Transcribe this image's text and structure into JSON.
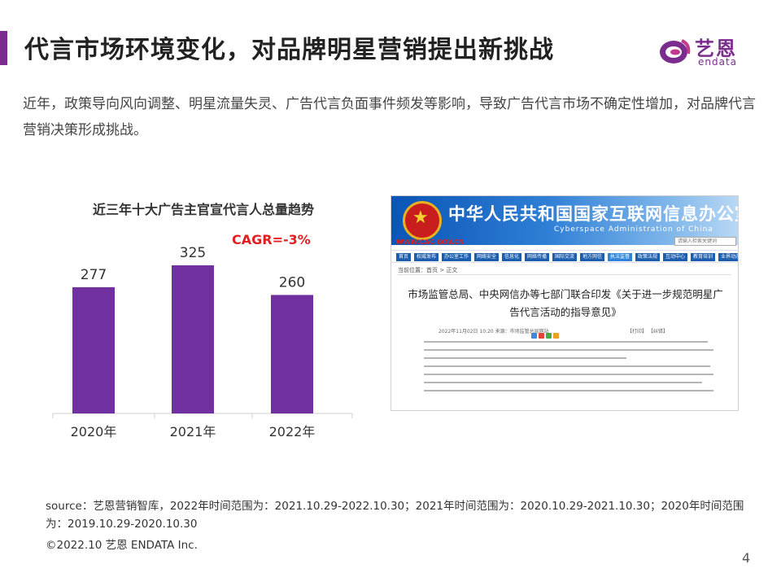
{
  "header": {
    "title": "代言市场环境变化，对品牌明星营销提出新挑战"
  },
  "logo": {
    "cn": "艺恩",
    "en": "endata"
  },
  "intro": "近年，政策导向风向调整、明星流量失灵、广告代言负面事件频发等影响，导致广告代言市场不确定性增加，对品牌代言营销决策形成挑战。",
  "chart_data": {
    "type": "bar",
    "title": "近三年十大广告主官宣代言人总量趋势",
    "categories": [
      "2020年",
      "2021年",
      "2022年"
    ],
    "values": [
      277,
      325,
      260
    ],
    "annotation": "CAGR=-3%",
    "ylim": [
      0,
      400
    ],
    "grid": false,
    "bar_color": "#7030a0",
    "annotation_color": "#e02020"
  },
  "screenshot": {
    "site_title": "中华人民共和国国家互联网信息办公室",
    "site_subtitle": "Cyberspace Administration of China",
    "url": "WWW.CAC.GOV.CN",
    "search_placeholder": "请输入检索关键词",
    "nav": [
      "首页",
      "权威发布",
      "办公室工作",
      "网络安全",
      "信息化",
      "网络传播",
      "国际交流",
      "地方网信",
      "执法监督",
      "政策法规",
      "互动中心",
      "教育培训",
      "业界动态",
      "工作专题"
    ],
    "breadcrumb": "当前位置：首页 > 正文",
    "headline": "市场监管总局、中央网信办等七部门联合印发《关于进一步规范明星广告代言活动的指导意见》",
    "meta": "2022年11月02日 10:20    来源：市场监管总局网站",
    "tools": "【打印】  【纠错】"
  },
  "footer": {
    "source": "source：艺恩营销智库，2022年时间范围为：2021.10.29-2022.10.30；2021年时间范围为：2020.10.29-2021.10.30；2020年时间范围为：2019.10.29-2020.10.30",
    "copyright": "©2022.10 艺恩 ENDATA Inc.",
    "page": "4"
  }
}
